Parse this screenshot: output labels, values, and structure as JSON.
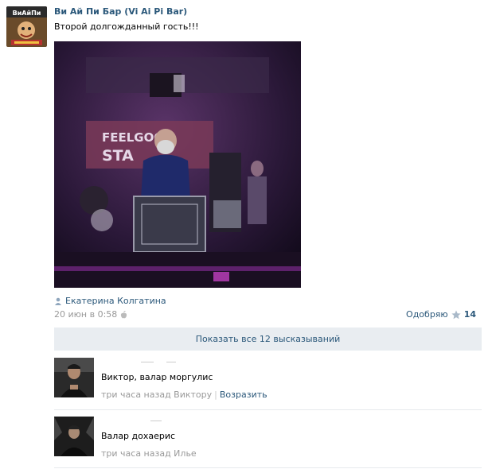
{
  "post": {
    "author": "Ви Ай Пи Бар (Vi Ai Pi Bar)",
    "text": "Второй долгожданный гость!!!",
    "avatar_text": "ВиАйПи",
    "signed_by": "Екатерина Колгатина",
    "date": "20 июн в 0:58",
    "like_label": "Одобряю",
    "like_count": "14"
  },
  "photo": {
    "sign_line1": "FEELGOO",
    "sign_line2": "STA"
  },
  "show_all": "Показать все 12 высказываний",
  "comments": [
    {
      "text": "Виктор, валар моргулис",
      "time": "три часа назад Виктору",
      "reply": "Возразить"
    },
    {
      "text": "Валар дохаерис",
      "time": "три часа назад Илье"
    }
  ],
  "colors": {
    "link": "#2b587a",
    "muted": "#999999",
    "bar": "#e9edf1"
  }
}
